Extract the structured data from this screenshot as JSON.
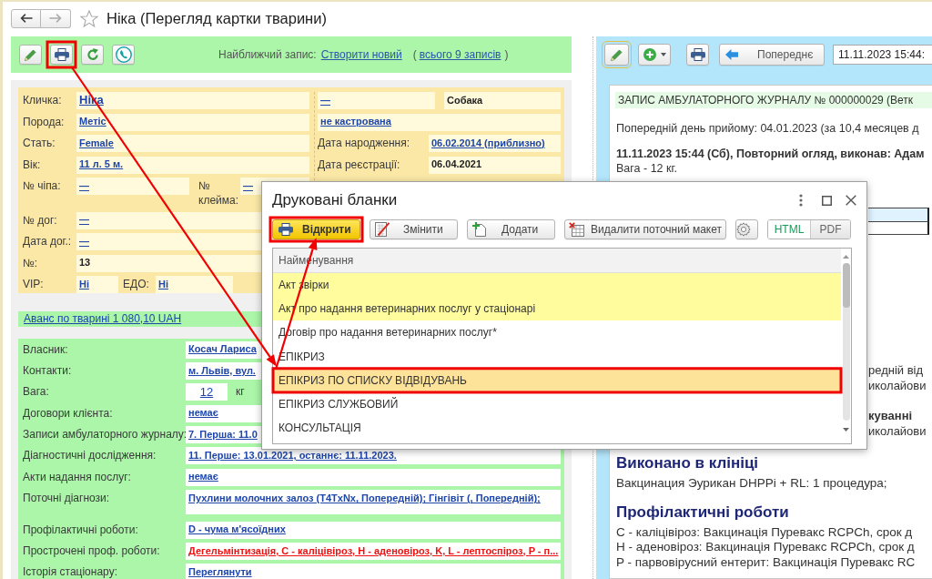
{
  "window": {
    "title": "Ніка (Перегляд картки тварини)",
    "nav_buttons": [
      {
        "kind": "back",
        "disabled": false
      },
      {
        "kind": "forward",
        "disabled": true
      }
    ]
  },
  "pet_panel": {
    "toolbar": {
      "nearest_label": "Найближчий запис:",
      "create_link": "Створити новий",
      "records_open": "(",
      "records_link": "всього 9 записів",
      "records_close": ")"
    },
    "card": {
      "left_rows": [
        {
          "kind": "single",
          "label": "Кличка:",
          "value": {
            "text": "Ніка",
            "link": true,
            "large": true
          }
        },
        {
          "kind": "single",
          "label": "Порода:",
          "value": {
            "text": "Метіс",
            "link": true
          }
        },
        {
          "kind": "single",
          "label": "Стать:",
          "value": {
            "text": "Female",
            "link": true
          }
        },
        {
          "kind": "single",
          "label": "Вік:",
          "value": {
            "text": "11 л. 5 м.",
            "link": true
          }
        },
        {
          "kind": "split",
          "label": "№ чіпа:",
          "value": {
            "text": "—",
            "link": true
          },
          "label_2": "№ клейма:",
          "value_2": {
            "text": "—",
            "link": true
          }
        },
        {
          "kind": "single",
          "label": "№ дог:",
          "value": {
            "text": "—",
            "link": true
          }
        },
        {
          "kind": "single",
          "label": "Дата дог.:",
          "value": {
            "text": "—",
            "link": true
          }
        },
        {
          "kind": "single",
          "label": "№:",
          "value": {
            "text": "13",
            "link": false
          }
        },
        {
          "kind": "short",
          "label": "VIP:",
          "value": {
            "text": "Ні",
            "link": true
          },
          "label_2": "ЕДО:",
          "value_2": {
            "text": "Ні",
            "link": true
          }
        }
      ],
      "right_rows": [
        {
          "kind": "double",
          "value": {
            "text": "—",
            "link": true
          },
          "value_2": {
            "text": "Собака",
            "link": false
          }
        },
        {
          "kind": "wide",
          "value": {
            "text": "не кастрована",
            "link": true
          }
        },
        {
          "kind": "single",
          "label": "Дата народження:",
          "value": {
            "text": "06.02.2014 (приблизно)",
            "link": true
          }
        },
        {
          "kind": "single",
          "label": "Дата реєстрації:",
          "value": {
            "text": "06.04.2021",
            "link": false
          }
        }
      ]
    },
    "advance_link": "Аванс по тварині 1 080,10 UAH",
    "owner_rows": [
      {
        "kind": "link",
        "label": "Власник:",
        "value": "Косач Лариса"
      },
      {
        "kind": "link",
        "label": "Контакти:",
        "value": "м. Львів, вул."
      },
      {
        "kind": "weight",
        "label": "Вага:",
        "value": "12",
        "unit": "кг"
      },
      {
        "kind": "link",
        "label": "Договори клієнта:",
        "value": "немає"
      },
      {
        "kind": "link",
        "label": "Записи амбулаторного журналу:",
        "value": "7. Перша: 11.0"
      },
      {
        "kind": "link",
        "label": "Діагностичні дослідження:",
        "value": "11. Перше: 13.01.2021, останнє: 11.11.2023."
      },
      {
        "kind": "link",
        "label": "Акти надання послуг:",
        "value": "немає"
      },
      {
        "kind": "tall",
        "label": "Поточні діагнози:",
        "value": "Пухлини молочних залоз (T4TxNx, Попередній); Гінгівіт (, Попередній);"
      },
      {
        "kind": "link",
        "label": "Профілактичні роботи:",
        "value": "D - чума м'ясоїдних"
      },
      {
        "kind": "overdue",
        "label": "Прострочені проф. роботи:",
        "value": "Дегельмінтизація, C - каліцівіроз, H - аденовіроз, K, L - лептоспіроз, P - п..."
      },
      {
        "kind": "link",
        "label": "Історія стаціонару:",
        "value": "Переглянути"
      }
    ]
  },
  "journal_panel": {
    "toolbar": {
      "buttons": [
        {
          "kind": "edit",
          "focused": true
        },
        {
          "kind": "add",
          "focused": false
        },
        {
          "kind": "print",
          "focused": false
        }
      ],
      "prev_button": "Попереднє",
      "date_field": "11.11.2023 15:44:"
    },
    "document": {
      "header": "ЗАПИС АМБУЛАТОРНОГО ЖУРНАЛУ № 000000029 (Ветк",
      "previous_visit": "Попередній день прийому: 04.01.2023 (за 10,4 месяцев д",
      "visit_title": "11.11.2023 15:44 (Сб), Повторний огляд, виконав: Адам",
      "visit_weight": "Вага - 12 кг.",
      "fragment_blocks": [
        {
          "lines": [
            {
              "text": "редній від",
              "bold": false
            },
            {
              "text": "иколайови",
              "bold": false
            }
          ]
        },
        {
          "lines": [
            {
              "text": "куванні",
              "bold": true
            },
            {
              "text": "иколайови",
              "bold": false
            }
          ]
        }
      ],
      "sections": [
        {
          "title": "Виконано в клініці",
          "lines": [
            "Вакцинация Эурикан DHPPi + RL: 1 процедура;"
          ]
        },
        {
          "title": "Профілактичні роботи",
          "lines": [
            "C - каліцівіроз: Вакцинація Пуревакс RCPCh, срок д",
            "H - аденовіроз: Вакцинація Пуревакс RCPCh, срок д",
            "P - парвовірусний ентерит: Вакцинація Пуревакс RC"
          ]
        }
      ]
    }
  },
  "print_dialog": {
    "title": "Друковані бланки",
    "buttons": [
      {
        "kind": "open",
        "label": "Відкрити",
        "default": true
      },
      {
        "kind": "edit",
        "label": "Змінити",
        "default": false
      },
      {
        "kind": "add",
        "label": "Додати",
        "default": false
      },
      {
        "kind": "delete",
        "label": "Видалити поточний макет",
        "default": false
      }
    ],
    "format_tabs": [
      {
        "label": "HTML",
        "selected": true
      },
      {
        "label": "PDF",
        "selected": false
      }
    ],
    "list": {
      "column": "Найменування",
      "rows": [
        {
          "name": "Акт звірки",
          "highlighted": true,
          "selected": false
        },
        {
          "name": "Акт про надання ветеринарних послуг у стаціонарі",
          "highlighted": true,
          "selected": false
        },
        {
          "name": "Договір про надання ветеринарних послуг*",
          "highlighted": false,
          "selected": false
        },
        {
          "name": "ЕПІКРИЗ",
          "highlighted": false,
          "selected": false
        },
        {
          "name": "ЕПІКРИЗ ПО СПИСКУ ВІДВІДУВАНЬ",
          "highlighted": false,
          "selected": true
        },
        {
          "name": "ЕПІКРИЗ СЛУЖБОВИЙ",
          "highlighted": false,
          "selected": false
        },
        {
          "name": "КОНСУЛЬТАЦІЯ",
          "highlighted": false,
          "selected": false
        }
      ]
    }
  }
}
